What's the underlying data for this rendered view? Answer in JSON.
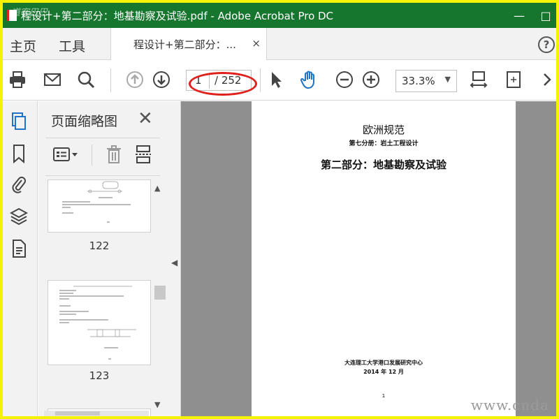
{
  "window": {
    "title": "程设计+第二部分：地基勘察及试验.pdf - Adobe Acrobat Pro DC",
    "minimize_glyph": "—",
    "maximize_glyph": "□"
  },
  "menu_tabs": {
    "home": "主页",
    "tools": "工具"
  },
  "document_tab": {
    "label": "程设计+第二部分：...",
    "close_glyph": "×"
  },
  "help_glyph": "?",
  "toolbar": {
    "current_page": "1",
    "total_pages": "/ 252",
    "zoom": "33.3%",
    "zoom_caret": "▼"
  },
  "colors": {
    "titlebar": "#17762e",
    "accent_blue": "#1f73c8",
    "annotation_red": "#e0201a",
    "frame_yellow": "#f5f206"
  },
  "panel": {
    "title": "页面缩略图",
    "close_glyph": "✕",
    "thumbnails": [
      {
        "page": "122"
      },
      {
        "page": "123"
      }
    ]
  },
  "collapse_glyph": "◀",
  "scroll": {
    "up_glyph": "▲",
    "down_glyph": "▼"
  },
  "document_page": {
    "title": "欧洲规范",
    "subtitle": "第七分册：岩土工程设计",
    "main_heading": "第二部分：地基勘察及试验",
    "institution": "大连理工大学港口发展研究中心",
    "date": "2014 年 12 月",
    "page_number": "1"
  },
  "watermarks": {
    "bottom_right": "www.cnda",
    "top_left": "道客巴巴"
  }
}
